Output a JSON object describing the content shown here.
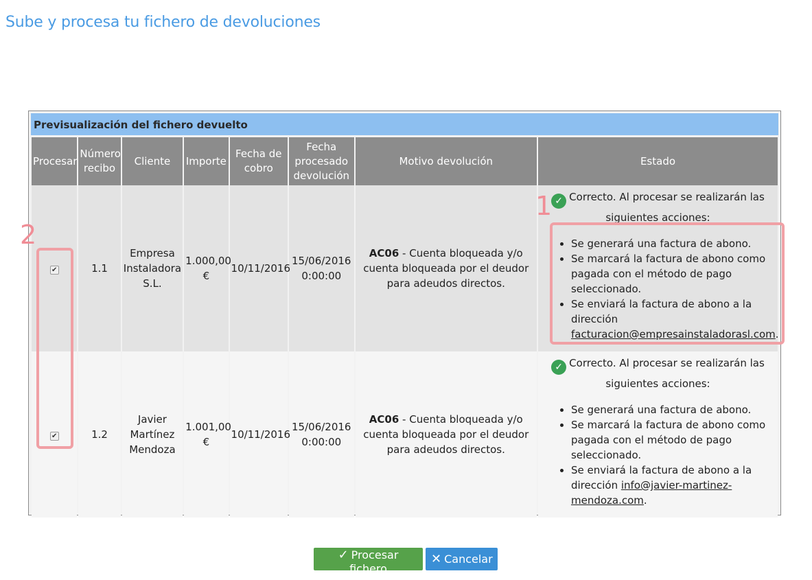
{
  "page": {
    "title": "Sube y procesa tu fichero de devoluciones"
  },
  "panel": {
    "header": "Previsualización del fichero devuelto"
  },
  "table": {
    "columns": [
      "Procesar",
      "Número recibo",
      "Cliente",
      "Importe",
      "Fecha de cobro",
      "Fecha procesado devolución",
      "Motivo devolución",
      "Estado"
    ],
    "rows": [
      {
        "checked": true,
        "recibo": "1.1",
        "cliente": "Empresa Instaladora S.L.",
        "importe": "1.000,00 €",
        "fecha_cobro": "10/11/2016",
        "fecha_procesado": "15/06/2016 0:00:00",
        "motivo_code": "AC06",
        "motivo_text": " - Cuenta bloqueada y/o cuenta bloqueada por el deudor para adeudos directos.",
        "estado_head": "Correcto. Al procesar se realizarán las siguientes acciones:",
        "acciones": [
          "Se generará una factura de abono.",
          "Se marcará la factura de abono como pagada con el método de pago seleccionado.",
          "Se enviará la factura de abono a la dirección "
        ],
        "email": "facturacion@empresainstaladorasl.com"
      },
      {
        "checked": true,
        "recibo": "1.2",
        "cliente": "Javier Martínez Mendoza",
        "importe": "1.001,00 €",
        "fecha_cobro": "10/11/2016",
        "fecha_procesado": "15/06/2016 0:00:00",
        "motivo_code": "AC06",
        "motivo_text": " - Cuenta bloqueada y/o cuenta bloqueada por el deudor para adeudos directos.",
        "estado_head": "Correcto. Al procesar se realizarán las siguientes acciones:",
        "acciones": [
          "Se generará una factura de abono.",
          "Se marcará la factura de abono como pagada con el método de pago seleccionado.",
          "Se enviará la factura de abono a la dirección "
        ],
        "email": "info@javier-martinez-mendoza.com"
      }
    ]
  },
  "annotations": {
    "one": "1",
    "two": "2"
  },
  "buttons": {
    "procesar": "Procesar fichero",
    "cancelar": "Cancelar"
  },
  "icons": {
    "ok": "check-circle-icon",
    "procesar": "check-icon",
    "cancelar": "x-icon"
  },
  "colors": {
    "title": "#4a9be3",
    "header": "#8dbff0",
    "annotation": "#f0a0a5",
    "ok_button": "#56a24a",
    "cancel_button": "#3a8fd6"
  }
}
